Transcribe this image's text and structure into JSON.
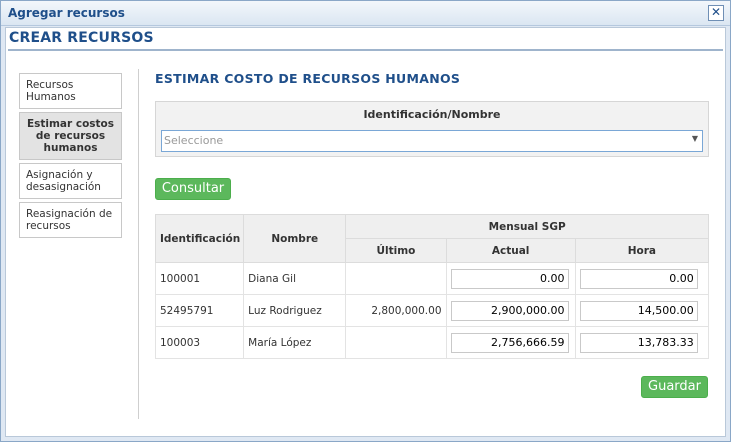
{
  "window": {
    "title": "Agregar recursos",
    "close_glyph": "✕"
  },
  "page": {
    "heading": "CREAR RECURSOS"
  },
  "nav": [
    {
      "label": "Recursos Humanos",
      "active": false
    },
    {
      "label": "Estimar costos de recursos humanos",
      "active": true
    },
    {
      "label": "Asignación y desasignación",
      "active": false
    },
    {
      "label": "Reasignación de recursos",
      "active": false
    }
  ],
  "main": {
    "title": "ESTIMAR COSTO DE RECURSOS HUMANOS",
    "id_label": "Identificación/Nombre",
    "select_placeholder": "Seleccione",
    "consult_label": "Consultar",
    "save_label": "Guardar"
  },
  "table": {
    "headers": {
      "identificacion": "Identificación",
      "nombre": "Nombre",
      "group": "Mensual SGP",
      "ultimo": "Último",
      "actual": "Actual",
      "hora": "Hora"
    },
    "rows": [
      {
        "identificacion": "100001",
        "nombre": "Diana Gil",
        "ultimo": "",
        "actual": "0.00",
        "hora": "0.00"
      },
      {
        "identificacion": "52495791",
        "nombre": "Luz Rodriguez",
        "ultimo": "2,800,000.00",
        "actual": "2,900,000.00",
        "hora": "14,500.00"
      },
      {
        "identificacion": "100003",
        "nombre": "María López",
        "ultimo": "",
        "actual": "2,756,666.59",
        "hora": "13,783.33"
      }
    ]
  },
  "colors": {
    "accent": "#1f4f8a",
    "button": "#5cb85c"
  }
}
